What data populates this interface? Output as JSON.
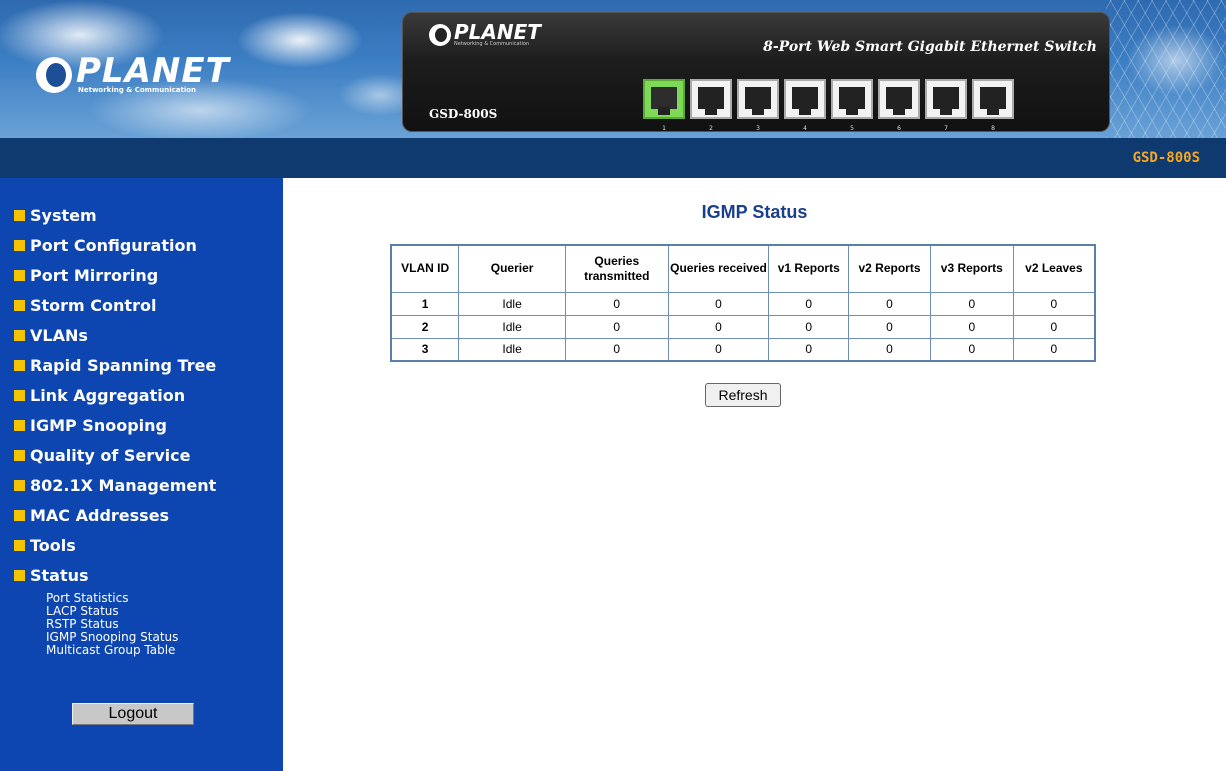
{
  "banner": {
    "brand_name": "PLANET",
    "brand_tagline": "Networking & Communication",
    "device_brand": "PLANET",
    "device_tagline": "Networking & Communication",
    "device_model": "GSD-800S",
    "device_description": "8-Port Web Smart Gigabit Ethernet Switch",
    "ports": [
      {
        "label": "1",
        "status": "active"
      },
      {
        "label": "2",
        "status": "inactive"
      },
      {
        "label": "3",
        "status": "inactive"
      },
      {
        "label": "4",
        "status": "inactive"
      },
      {
        "label": "5",
        "status": "inactive"
      },
      {
        "label": "6",
        "status": "inactive"
      },
      {
        "label": "7",
        "status": "inactive"
      },
      {
        "label": "8",
        "status": "inactive"
      }
    ]
  },
  "header": {
    "model": "GSD-800S"
  },
  "sidebar": {
    "items": [
      {
        "label": "System"
      },
      {
        "label": "Port Configuration"
      },
      {
        "label": "Port Mirroring"
      },
      {
        "label": "Storm Control"
      },
      {
        "label": "VLANs"
      },
      {
        "label": "Rapid Spanning Tree"
      },
      {
        "label": "Link Aggregation"
      },
      {
        "label": "IGMP Snooping"
      },
      {
        "label": "Quality of Service"
      },
      {
        "label": "802.1X Management"
      },
      {
        "label": "MAC Addresses"
      },
      {
        "label": "Tools"
      },
      {
        "label": "Status"
      }
    ],
    "sub_items": [
      {
        "label": "Port Statistics"
      },
      {
        "label": "LACP Status"
      },
      {
        "label": "RSTP Status"
      },
      {
        "label": "IGMP Snooping Status"
      },
      {
        "label": "Multicast Group Table"
      }
    ],
    "logout_label": "Logout"
  },
  "main": {
    "title": "IGMP Status",
    "table": {
      "headers": [
        "VLAN ID",
        "Querier",
        "Queries transmitted",
        "Queries received",
        "v1 Reports",
        "v2 Reports",
        "v3 Reports",
        "v2 Leaves"
      ],
      "rows": [
        [
          "1",
          "Idle",
          "0",
          "0",
          "0",
          "0",
          "0",
          "0"
        ],
        [
          "2",
          "Idle",
          "0",
          "0",
          "0",
          "0",
          "0",
          "0"
        ],
        [
          "3",
          "Idle",
          "0",
          "0",
          "0",
          "0",
          "0",
          "0"
        ]
      ]
    },
    "refresh_label": "Refresh"
  },
  "colors": {
    "sidebar_bg": "#0d46b0",
    "header_bar_bg": "#0f3a6f",
    "header_model": "#f5a623",
    "menu_bullet": "#f5c400",
    "title": "#1a3f8f",
    "port_active": "#7ed957"
  }
}
